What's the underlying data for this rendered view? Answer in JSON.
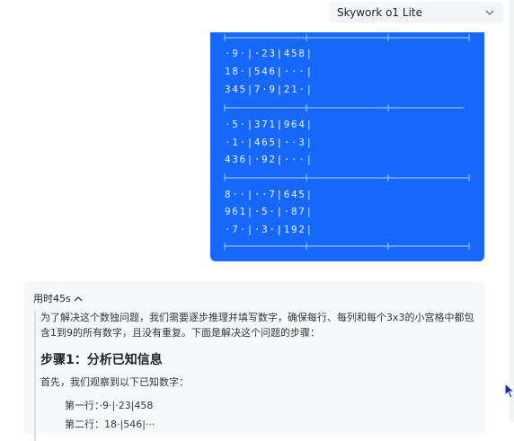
{
  "model_selector": {
    "label": "Skywork o1 Lite",
    "icon": "chevron-down-icon"
  },
  "user_message": {
    "sudoku_rows": [
      "·9·|·23|458|",
      "18·|546|···|",
      "345|7·9|21·|",
      "·5·|371|964|",
      "·1·|465|··3|",
      "436|·92|···|",
      "8··|··7|645|",
      "961|·5·|·87|",
      "·7·|·3·|192|"
    ],
    "colors": {
      "bubble": "#1668fb"
    }
  },
  "assistant": {
    "elapsed_label": "用时45s",
    "collapse_icon": "chevron-up-icon",
    "intro": "为了解决这个数独问题，我们需要逐步推理并填写数字，确保每行、每列和每个3x3的小宫格中都包含1到9的所有数字，且没有重复。下面是解决这个问题的步骤：",
    "step1_title": "步骤1：分析已知信息",
    "known_intro": "首先，我们观察到以下已知数字：",
    "row_lines": [
      "第一行：·9·|·23|458",
      "第二行：18·|546|···"
    ]
  }
}
